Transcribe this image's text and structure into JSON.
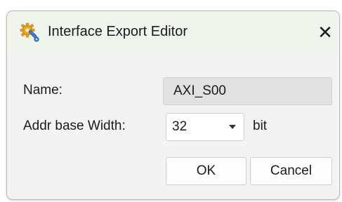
{
  "window": {
    "title": "Interface Export Editor",
    "icon": "wrench-gear-icon",
    "close_glyph": "✕"
  },
  "form": {
    "name_label": "Name:",
    "name_value": "AXI_S00",
    "width_label": "Addr base Width:",
    "width_value": "32",
    "width_unit": "bit"
  },
  "buttons": {
    "ok_label": "OK",
    "cancel_label": "Cancel"
  },
  "colors": {
    "titlebar_bg": "#eff4ec",
    "dialog_bg": "#f3f3f3",
    "disabled_field_bg": "#e1e1e1",
    "icon_gear": "#f2a51a",
    "icon_wrench": "#3a7fd5"
  }
}
